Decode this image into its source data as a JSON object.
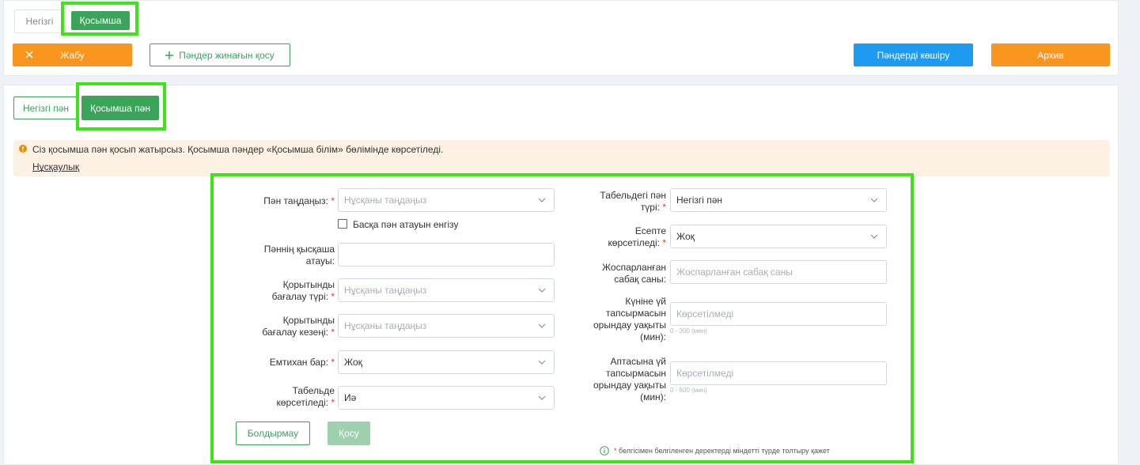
{
  "top_tabs": {
    "main": "Негізгі",
    "extra": "Қосымша"
  },
  "toolbar": {
    "close_label": "Жабу",
    "add_set_label": "Пәндер жинағын қосу",
    "copy_label": "Пәндерді көшіру",
    "archive_label": "Архив"
  },
  "subject_tabs": {
    "main": "Негізгі пән",
    "extra": "Қосымша пән"
  },
  "notice": {
    "text": "Сіз қосымша пән қосып жатырсыз. Қосымша пәндер «Қосымша білім» бөлімінде көрсетіледі.",
    "link": "Нұсқаулық"
  },
  "form": {
    "subject_select": {
      "label": "Пән таңдаңыз:",
      "placeholder": "Нұсқаны таңдаңыз"
    },
    "other_name_checkbox": "Басқа пән атауын енгізу",
    "short_name": {
      "label_1": "Пәннің қысқаша",
      "label_2": "атауы:",
      "value": ""
    },
    "final_grading_type": {
      "label_1": "Қорытынды",
      "label_2": "бағалау түрі:",
      "placeholder": "Нұсқаны таңдаңыз"
    },
    "final_grading_period": {
      "label_1": "Қорытынды",
      "label_2": "бағалау кезеңі:",
      "placeholder": "Нұсқаны таңдаңыз"
    },
    "exam": {
      "label": "Емтихан бар:",
      "value": "Жоқ"
    },
    "show_in_table": {
      "label_1": "Табельде",
      "label_2": "көрсетіледі:",
      "value": "Иә"
    },
    "table_subject_type": {
      "label_1": "Табельдегі пән",
      "label_2": "түрі:",
      "value": "Негізгі пән"
    },
    "show_in_report": {
      "label_1": "Есепте",
      "label_2": "көрсетіледі:",
      "value": "Жоқ"
    },
    "planned_lessons": {
      "label_1": "Жоспарланған",
      "label_2": "сабақ саны:",
      "placeholder": "Жоспарланған сабақ саны"
    },
    "daily_homework": {
      "label_1": "Күніне үй",
      "label_2": "тапсырмасын",
      "label_3": "орындау уақыты",
      "label_4": "(мин):",
      "placeholder": "Көрсетілмеді",
      "hint": "0 - 300 (мин)"
    },
    "weekly_homework": {
      "label_1": "Аптасына үй",
      "label_2": "тапсырмасын",
      "label_3": "орындау уақыты",
      "label_4": "(мин):",
      "placeholder": "Көрсетілмеді",
      "hint": "0 - 600 (мин)"
    },
    "cancel_label": "Болдырмау",
    "submit_label": "Қосу",
    "required_note": "белгісімен белгіленген деректерді міндетті түрде толтыру қажет",
    "required_mark": "*"
  },
  "colors": {
    "accent_green": "#3aa45a",
    "orange": "#f7951e",
    "blue": "#1e9bf0",
    "highlight": "#3fe31a"
  }
}
